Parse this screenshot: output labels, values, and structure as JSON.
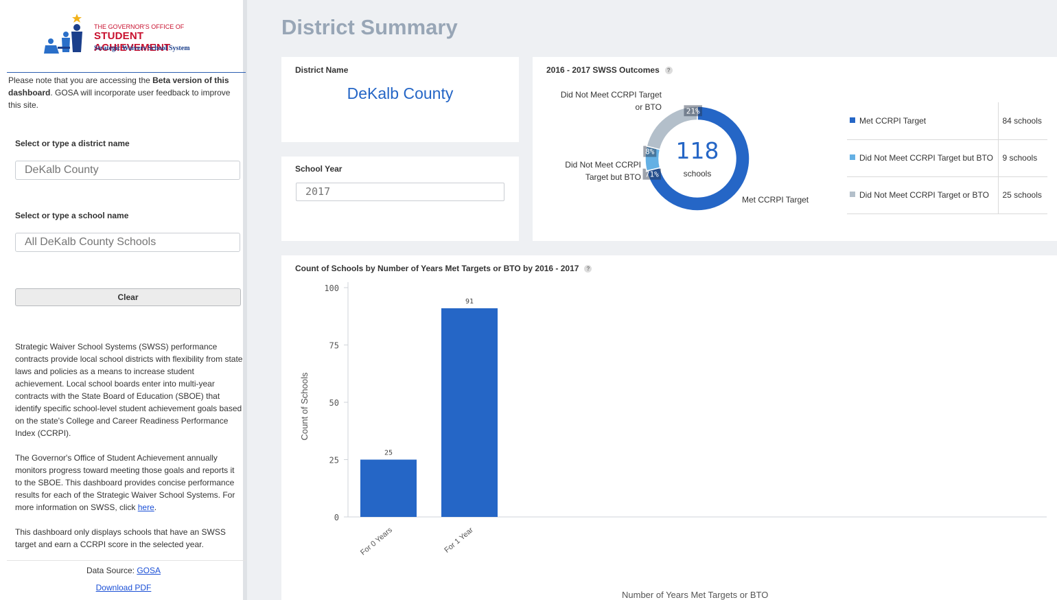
{
  "sidebar": {
    "logo": {
      "line1": "THE GOVERNOR'S OFFICE OF",
      "line2": "STUDENT ACHIEVEMENT",
      "line3": "Strategic Waivers School System"
    },
    "note": {
      "prefix": "Please note that you are accessing the ",
      "bold1": "Beta version of this dashboard",
      "suffix": ". GOSA will incorporate user feedback to improve this site."
    },
    "district_label": "Select or type a district name",
    "district_value": "DeKalb County",
    "school_label": "Select or type a school name",
    "school_value": "All DeKalb County Schools",
    "clear_label": "Clear",
    "about_p1": "Strategic Waiver School Systems (SWSS) performance contracts provide local school districts with flexibility from state laws and policies as a means to increase student achievement. Local school boards enter into multi-year contracts with the State Board of Education (SBOE) that identify specific school-level student achievement goals based on the state's College and Career Readiness Performance Index (CCRPI).",
    "about_p2": "The Governor's Office of Student Achievement annually monitors progress toward meeting those goals and reports it to the SBOE. This dashboard provides concise performance results for each of the Strategic Waiver School Systems. For more information on SWSS, click ",
    "about_p2_link": "here",
    "about_p2_end": ".",
    "about_p3": "This dashboard only displays schools that have an SWSS target and earn a CCRPI score in the selected year.",
    "data_source_label": "Data Source: ",
    "data_source_link": "GOSA",
    "download_label": "Download PDF"
  },
  "main": {
    "title": "District Summary",
    "district_card": {
      "title": "District Name",
      "value": "DeKalb County"
    },
    "year_card": {
      "title": "School Year",
      "value": "2017"
    },
    "outcomes_card": {
      "title": "2016 - 2017 SWSS Outcomes",
      "help": "?",
      "total": "118",
      "total_unit": "schools",
      "labels": {
        "not_met": [
          "Did Not Meet CCRPI Target",
          "or BTO"
        ],
        "bto": [
          "Did Not Meet CCRPI",
          "Target but BTO"
        ],
        "met": "Met CCRPI Target"
      },
      "legend": [
        {
          "label": "Met CCRPI Target",
          "value": "84 schools",
          "color": "#2566c6"
        },
        {
          "label": "Did Not Meet CCRPI Target but BTO",
          "value": "9 schools",
          "color": "#64b0e4"
        },
        {
          "label": "Did Not Meet CCRPI Target or BTO",
          "value": "25 schools",
          "color": "#b3bfca"
        }
      ]
    },
    "bar_card": {
      "title": "Count of Schools by Number of Years Met Targets or BTO by 2016 - 2017",
      "help": "?"
    }
  },
  "chart_data": [
    {
      "type": "pie",
      "title": "2016 - 2017 SWSS Outcomes",
      "categories": [
        "Met CCRPI Target",
        "Did Not Meet CCRPI Target but BTO",
        "Did Not Meet CCRPI Target or BTO"
      ],
      "values": [
        84,
        9,
        25
      ],
      "percent_labels": [
        "71%",
        "8%",
        "21%"
      ],
      "colors": [
        "#2566c6",
        "#64b0e4",
        "#b3bfca"
      ],
      "center_text": "118"
    },
    {
      "type": "bar",
      "title": "Count of Schools by Number of Years Met Targets or BTO by 2016 - 2017",
      "categories": [
        "For 0 Years",
        "For 1 Year"
      ],
      "values": [
        25,
        91
      ],
      "xlabel": "Number of Years Met Targets or BTO",
      "ylabel": "Count of Schools",
      "ylim": [
        0,
        100
      ],
      "yticks": [
        0,
        25,
        50,
        75,
        100
      ],
      "color": "#2566c6"
    }
  ]
}
